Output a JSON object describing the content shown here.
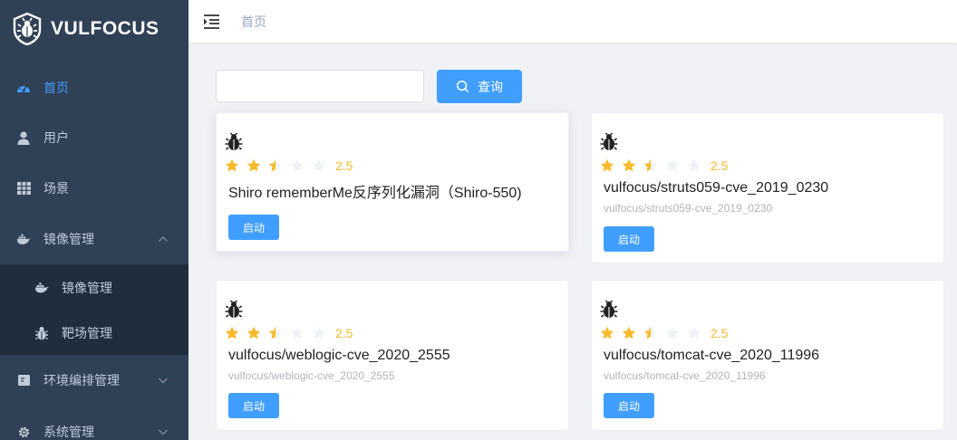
{
  "app": {
    "title": "VULFOCUS"
  },
  "sidebar": {
    "items": [
      {
        "label": "首页",
        "icon": "dashboard-icon",
        "active": true
      },
      {
        "label": "用户",
        "icon": "user-icon"
      },
      {
        "label": "场景",
        "icon": "table-icon"
      },
      {
        "label": "镜像管理",
        "icon": "docker-icon",
        "expanded": true,
        "children": [
          {
            "label": "镜像管理",
            "icon": "docker-icon"
          },
          {
            "label": "靶场管理",
            "icon": "bug-icon"
          }
        ]
      },
      {
        "label": "环境编排管理",
        "icon": "form-icon"
      },
      {
        "label": "系统管理",
        "icon": "gear-icon"
      }
    ]
  },
  "header": {
    "breadcrumb": "首页"
  },
  "search": {
    "value": "",
    "placeholder": "",
    "button_label": "查询"
  },
  "cards": [
    {
      "rating": 2.5,
      "rating_text": "2.5",
      "title": "Shiro rememberMe反序列化漏洞（Shiro-550)",
      "subtitle": "",
      "button": "启动"
    },
    {
      "rating": 2.5,
      "rating_text": "2.5",
      "title": "vulfocus/struts059-cve_2019_0230",
      "subtitle": "vulfocus/struts059-cve_2019_0230",
      "button": "启动"
    },
    {
      "rating": 2.5,
      "rating_text": "2.5",
      "title": "vulfocus/weblogic-cve_2020_2555",
      "subtitle": "vulfocus/weblogic-cve_2020_2555",
      "button": "启动"
    },
    {
      "rating": 2.5,
      "rating_text": "2.5",
      "title": "vulfocus/tomcat-cve_2020_11996",
      "subtitle": "vulfocus/tomcat-cve_2020_11996",
      "button": "启动"
    }
  ],
  "colors": {
    "accent": "#409eff",
    "sidebar_bg": "#304156",
    "submenu_bg": "#1f2d3d",
    "star": "#f7ba2a",
    "star_empty": "#eff2f7"
  }
}
